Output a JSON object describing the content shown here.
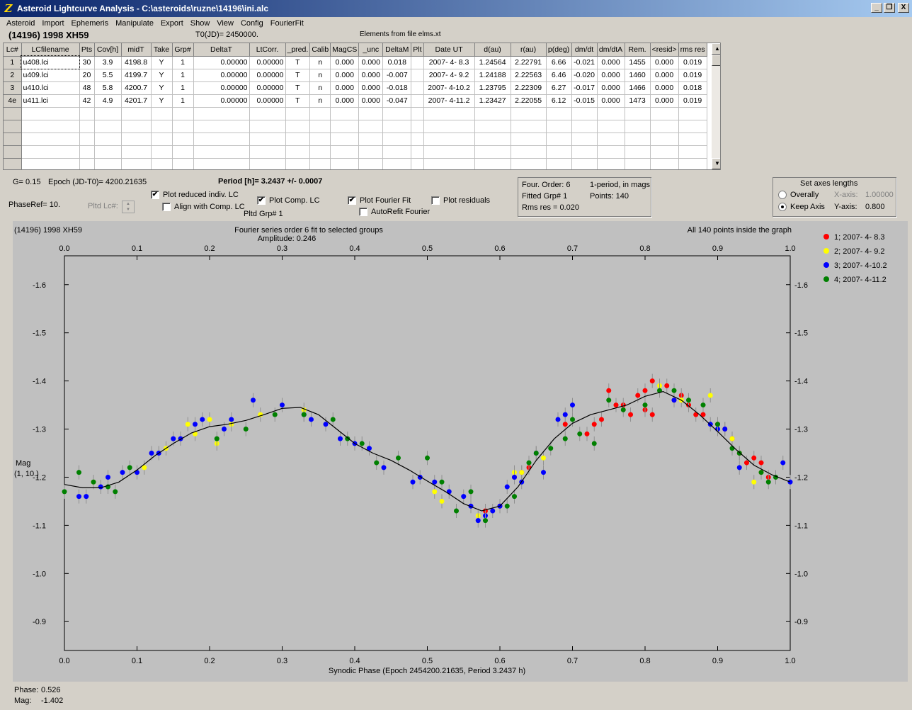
{
  "window": {
    "title": "Asteroid Lightcurve Analysis - C:\\asteroids\\ruzne\\14196\\ini.alc",
    "minimize": "_",
    "maximize": "❐",
    "close": "X"
  },
  "menu": [
    "Asteroid",
    "Import",
    "Ephemeris",
    "Manipulate",
    "Export",
    "Show",
    "View",
    "Config",
    "FourierFit"
  ],
  "header": {
    "object": "(14196) 1998 XH59",
    "t0": "T0(JD)= 2450000.",
    "elements": "Elements from file elms.xt"
  },
  "table": {
    "columns": [
      "Lc#",
      "LCfilename",
      "Pts",
      "Cov[h]",
      "midT",
      "Take",
      "Grp#",
      "DeltaT",
      "LtCorr.",
      "_pred.",
      "Calib",
      "MagCS",
      "_unc",
      "DeltaM",
      "Plt",
      "Date UT",
      "d(au)",
      "r(au)",
      "p(deg)",
      "dm/dt",
      "dm/dtA",
      "Rem.",
      "<resid>",
      "rms res"
    ],
    "rows": [
      [
        "1",
        "u408.lci",
        "30",
        "3.9",
        "4198.8",
        "Y",
        "1",
        "0.00000",
        "0.00000",
        "T",
        "n",
        "0.000",
        "0.000",
        "0.018",
        "",
        "2007- 4- 8.3",
        "1.24564",
        "2.22791",
        "6.66",
        "-0.021",
        "0.000",
        "1455",
        "0.000",
        "0.019"
      ],
      [
        "2",
        "u409.lci",
        "20",
        "5.5",
        "4199.7",
        "Y",
        "1",
        "0.00000",
        "0.00000",
        "T",
        "n",
        "0.000",
        "0.000",
        "-0.007",
        "",
        "2007- 4- 9.2",
        "1.24188",
        "2.22563",
        "6.46",
        "-0.020",
        "0.000",
        "1460",
        "0.000",
        "0.019"
      ],
      [
        "3",
        "u410.lci",
        "48",
        "5.8",
        "4200.7",
        "Y",
        "1",
        "0.00000",
        "0.00000",
        "T",
        "n",
        "0.000",
        "0.000",
        "-0.018",
        "",
        "2007- 4-10.2",
        "1.23795",
        "2.22309",
        "6.27",
        "-0.017",
        "0.000",
        "1466",
        "0.000",
        "0.018"
      ],
      [
        "4e",
        "u411.lci",
        "42",
        "4.9",
        "4201.7",
        "Y",
        "1",
        "0.00000",
        "0.00000",
        "T",
        "n",
        "0.000",
        "0.000",
        "-0.047",
        "",
        "2007- 4-11.2",
        "1.23427",
        "2.22055",
        "6.12",
        "-0.015",
        "0.000",
        "1473",
        "0.000",
        "0.019"
      ]
    ],
    "empty_rows": 6
  },
  "controls": {
    "g": "G= 0.15",
    "epoch": "Epoch (JD-T0)= 4200.21635",
    "period": "Period [h]= 3.2437 +/- 0.0007",
    "phaseref": "PhaseRef= 10.",
    "pltd_lc": "Pltd Lc#:",
    "plot_reduced": "Plot reduced indiv. LC",
    "plot_reduced_checked": true,
    "align_comp": "Align with Comp. LC",
    "align_comp_checked": false,
    "plot_comp": "Plot Comp. LC",
    "plot_comp_checked": true,
    "pltd_grp": "Pltd Grp#  1",
    "plot_fourier": "Plot Fourier Fit",
    "plot_fourier_checked": true,
    "autorefit": "AutoRefit Fourier",
    "autorefit_checked": false,
    "plot_residuals": "Plot residuals",
    "plot_residuals_checked": false
  },
  "fourier_info": {
    "order": "Four. Order:  6",
    "mode": "1-period, in mags",
    "grp": "Fitted Grp# 1",
    "points": "Points: 140",
    "rms": "Rms res     = 0.020"
  },
  "axes_box": {
    "title": "Set axes lengths",
    "overally": "Overally",
    "keep_axis": "Keep Axis",
    "selected": "keep_axis",
    "xaxis_label": "X-axis:",
    "xaxis_value": "1.00000",
    "yaxis_label": "Y-axis:",
    "yaxis_value": "0.800"
  },
  "footer": {
    "phase_label": "Phase:",
    "phase_value": "0.526",
    "mag_label": "Mag:",
    "mag_value": "-1.402"
  },
  "colors": {
    "red": "#ff0000",
    "yellow": "#ffff00",
    "blue": "#0000ff",
    "green": "#008000",
    "plot_bg": "#c0c0c0"
  },
  "chart_data": {
    "type": "scatter",
    "title_left": "(14196) 1998 XH59",
    "title_center": "Fourier series order 6 fit to selected groups",
    "amplitude": "Amplitude: 0.246",
    "title_right": "All 140 points inside the graph",
    "xlabel": "Synodic Phase (Epoch 2454200.21635, Period 3.2437 h)",
    "ylabel": "Mag",
    "ylabel2": "(1, 10.)",
    "xlim": [
      0.0,
      1.0
    ],
    "ylim": [
      -1.66,
      -0.84
    ],
    "y_reversed": true,
    "xticks": [
      "0.0",
      "0.1",
      "0.2",
      "0.3",
      "0.4",
      "0.5",
      "0.6",
      "0.7",
      "0.8",
      "0.9",
      "1.0"
    ],
    "yticks": [
      "-1.6",
      "-1.5",
      "-1.4",
      "-1.3",
      "-1.2",
      "-1.1",
      "-1.0",
      "-0.9"
    ],
    "legend": [
      "1; 2007- 4- 8.3",
      "2; 2007- 4- 9.2",
      "3; 2007- 4-10.2",
      "4; 2007- 4-11.2"
    ],
    "series": [
      {
        "name": "1; 2007- 4- 8.3",
        "color": "#ff0000",
        "points": [
          [
            0.58,
            -1.13
          ],
          [
            0.6,
            -1.14
          ],
          [
            0.62,
            -1.2
          ],
          [
            0.63,
            -1.21
          ],
          [
            0.64,
            -1.22
          ],
          [
            0.69,
            -1.31
          ],
          [
            0.72,
            -1.29
          ],
          [
            0.73,
            -1.31
          ],
          [
            0.74,
            -1.32
          ],
          [
            0.75,
            -1.38
          ],
          [
            0.76,
            -1.35
          ],
          [
            0.77,
            -1.35
          ],
          [
            0.78,
            -1.33
          ],
          [
            0.79,
            -1.37
          ],
          [
            0.8,
            -1.34
          ],
          [
            0.81,
            -1.33
          ],
          [
            0.8,
            -1.38
          ],
          [
            0.81,
            -1.4
          ],
          [
            0.83,
            -1.39
          ],
          [
            0.84,
            -1.36
          ],
          [
            0.85,
            -1.37
          ],
          [
            0.86,
            -1.35
          ],
          [
            0.87,
            -1.33
          ],
          [
            0.88,
            -1.33
          ],
          [
            0.9,
            -1.31
          ],
          [
            0.91,
            -1.3
          ],
          [
            0.92,
            -1.28
          ],
          [
            0.93,
            -1.25
          ],
          [
            0.94,
            -1.23
          ],
          [
            0.95,
            -1.24
          ],
          [
            0.96,
            -1.23
          ],
          [
            0.96,
            -1.21
          ],
          [
            0.97,
            -1.2
          ]
        ]
      },
      {
        "name": "2; 2007- 4- 9.2",
        "color": "#ffff00",
        "points": [
          [
            0.04,
            -1.19
          ],
          [
            0.11,
            -1.22
          ],
          [
            0.14,
            -1.26
          ],
          [
            0.17,
            -1.31
          ],
          [
            0.18,
            -1.29
          ],
          [
            0.2,
            -1.32
          ],
          [
            0.21,
            -1.27
          ],
          [
            0.23,
            -1.31
          ],
          [
            0.27,
            -1.33
          ],
          [
            0.3,
            -1.35
          ],
          [
            0.33,
            -1.34
          ],
          [
            0.51,
            -1.17
          ],
          [
            0.52,
            -1.15
          ],
          [
            0.57,
            -1.12
          ],
          [
            0.62,
            -1.21
          ],
          [
            0.63,
            -1.21
          ],
          [
            0.66,
            -1.24
          ],
          [
            0.82,
            -1.39
          ],
          [
            0.85,
            -1.36
          ],
          [
            0.89,
            -1.37
          ],
          [
            0.92,
            -1.28
          ],
          [
            0.95,
            -1.19
          ],
          [
            0.96,
            -1.21
          ]
        ]
      },
      {
        "name": "3; 2007- 4-10.2",
        "color": "#0000ff",
        "points": [
          [
            0.02,
            -1.16
          ],
          [
            0.03,
            -1.16
          ],
          [
            0.05,
            -1.18
          ],
          [
            0.06,
            -1.2
          ],
          [
            0.08,
            -1.21
          ],
          [
            0.1,
            -1.21
          ],
          [
            0.12,
            -1.25
          ],
          [
            0.13,
            -1.25
          ],
          [
            0.15,
            -1.28
          ],
          [
            0.16,
            -1.28
          ],
          [
            0.18,
            -1.31
          ],
          [
            0.19,
            -1.32
          ],
          [
            0.22,
            -1.3
          ],
          [
            0.23,
            -1.32
          ],
          [
            0.26,
            -1.36
          ],
          [
            0.3,
            -1.35
          ],
          [
            0.33,
            -1.33
          ],
          [
            0.34,
            -1.32
          ],
          [
            0.36,
            -1.31
          ],
          [
            0.38,
            -1.28
          ],
          [
            0.4,
            -1.27
          ],
          [
            0.42,
            -1.26
          ],
          [
            0.44,
            -1.22
          ],
          [
            0.48,
            -1.19
          ],
          [
            0.49,
            -1.2
          ],
          [
            0.51,
            -1.19
          ],
          [
            0.53,
            -1.17
          ],
          [
            0.55,
            -1.16
          ],
          [
            0.56,
            -1.14
          ],
          [
            0.57,
            -1.11
          ],
          [
            0.58,
            -1.12
          ],
          [
            0.59,
            -1.13
          ],
          [
            0.6,
            -1.14
          ],
          [
            0.61,
            -1.18
          ],
          [
            0.62,
            -1.2
          ],
          [
            0.63,
            -1.19
          ],
          [
            0.65,
            -1.25
          ],
          [
            0.66,
            -1.21
          ],
          [
            0.68,
            -1.32
          ],
          [
            0.69,
            -1.33
          ],
          [
            0.7,
            -1.35
          ],
          [
            0.84,
            -1.36
          ],
          [
            0.89,
            -1.31
          ],
          [
            0.9,
            -1.3
          ],
          [
            0.91,
            -1.3
          ],
          [
            0.93,
            -1.22
          ],
          [
            0.99,
            -1.23
          ],
          [
            1.0,
            -1.19
          ]
        ]
      },
      {
        "name": "4; 2007- 4-11.2",
        "color": "#008000",
        "points": [
          [
            0.0,
            -1.17
          ],
          [
            0.02,
            -1.21
          ],
          [
            0.04,
            -1.19
          ],
          [
            0.06,
            -1.18
          ],
          [
            0.07,
            -1.17
          ],
          [
            0.09,
            -1.22
          ],
          [
            0.21,
            -1.28
          ],
          [
            0.25,
            -1.3
          ],
          [
            0.29,
            -1.33
          ],
          [
            0.33,
            -1.33
          ],
          [
            0.37,
            -1.32
          ],
          [
            0.39,
            -1.28
          ],
          [
            0.41,
            -1.27
          ],
          [
            0.43,
            -1.23
          ],
          [
            0.46,
            -1.24
          ],
          [
            0.5,
            -1.24
          ],
          [
            0.52,
            -1.19
          ],
          [
            0.54,
            -1.13
          ],
          [
            0.56,
            -1.17
          ],
          [
            0.58,
            -1.11
          ],
          [
            0.61,
            -1.14
          ],
          [
            0.62,
            -1.16
          ],
          [
            0.64,
            -1.23
          ],
          [
            0.65,
            -1.25
          ],
          [
            0.67,
            -1.26
          ],
          [
            0.69,
            -1.28
          ],
          [
            0.7,
            -1.32
          ],
          [
            0.71,
            -1.29
          ],
          [
            0.73,
            -1.27
          ],
          [
            0.75,
            -1.36
          ],
          [
            0.77,
            -1.34
          ],
          [
            0.8,
            -1.35
          ],
          [
            0.82,
            -1.38
          ],
          [
            0.84,
            -1.38
          ],
          [
            0.86,
            -1.36
          ],
          [
            0.88,
            -1.35
          ],
          [
            0.9,
            -1.31
          ],
          [
            0.92,
            -1.26
          ],
          [
            0.93,
            -1.25
          ],
          [
            0.96,
            -1.21
          ],
          [
            0.97,
            -1.19
          ],
          [
            0.98,
            -1.2
          ]
        ]
      }
    ],
    "fit_curve": [
      [
        0.0,
        -1.185
      ],
      [
        0.025,
        -1.178
      ],
      [
        0.05,
        -1.178
      ],
      [
        0.075,
        -1.19
      ],
      [
        0.1,
        -1.215
      ],
      [
        0.125,
        -1.245
      ],
      [
        0.15,
        -1.27
      ],
      [
        0.175,
        -1.292
      ],
      [
        0.2,
        -1.305
      ],
      [
        0.225,
        -1.31
      ],
      [
        0.25,
        -1.318
      ],
      [
        0.275,
        -1.33
      ],
      [
        0.3,
        -1.343
      ],
      [
        0.325,
        -1.345
      ],
      [
        0.35,
        -1.33
      ],
      [
        0.375,
        -1.3
      ],
      [
        0.4,
        -1.27
      ],
      [
        0.425,
        -1.25
      ],
      [
        0.45,
        -1.235
      ],
      [
        0.475,
        -1.215
      ],
      [
        0.5,
        -1.192
      ],
      [
        0.525,
        -1.17
      ],
      [
        0.55,
        -1.145
      ],
      [
        0.575,
        -1.13
      ],
      [
        0.6,
        -1.14
      ],
      [
        0.625,
        -1.18
      ],
      [
        0.65,
        -1.235
      ],
      [
        0.675,
        -1.28
      ],
      [
        0.7,
        -1.312
      ],
      [
        0.725,
        -1.33
      ],
      [
        0.75,
        -1.34
      ],
      [
        0.775,
        -1.35
      ],
      [
        0.8,
        -1.368
      ],
      [
        0.825,
        -1.378
      ],
      [
        0.85,
        -1.36
      ],
      [
        0.875,
        -1.33
      ],
      [
        0.9,
        -1.295
      ],
      [
        0.925,
        -1.258
      ],
      [
        0.95,
        -1.225
      ],
      [
        0.975,
        -1.205
      ],
      [
        1.0,
        -1.19
      ]
    ]
  }
}
